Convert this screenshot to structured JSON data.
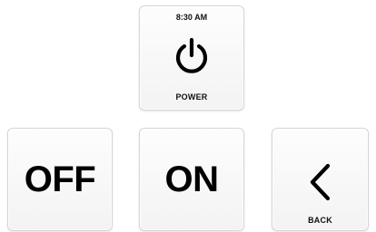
{
  "power_tile": {
    "time": "8:30 AM",
    "icon": "power-icon",
    "label": "POWER"
  },
  "off_tile": {
    "label": "OFF"
  },
  "on_tile": {
    "label": "ON"
  },
  "back_tile": {
    "icon": "chevron-left-icon",
    "label": "BACK"
  }
}
